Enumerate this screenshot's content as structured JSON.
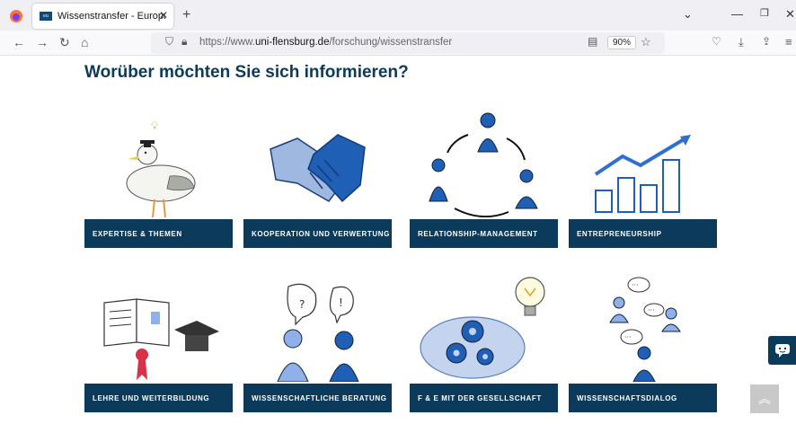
{
  "browser": {
    "tab_title": "Wissenstransfer - Europa-Unive",
    "tab_close": "✕",
    "new_tab": "+",
    "url_prefix": "https://www.",
    "url_domain": "uni-flensburg.de",
    "url_path": "/forschung/wissenstransfer",
    "zoom": "90%"
  },
  "page": {
    "title": "Worüber möchten Sie sich informieren?"
  },
  "cards": [
    {
      "label": "EXPERTISE & THEMEN",
      "icon": "seagull-graduate-icon"
    },
    {
      "label": "KOOPERATION UND VERWERTUNG",
      "icon": "handshake-icon"
    },
    {
      "label": "RELATIONSHIP-MANAGEMENT",
      "icon": "people-cycle-icon"
    },
    {
      "label": "ENTREPRENEURSHIP",
      "icon": "growth-chart-icon"
    },
    {
      "label": "LEHRE UND WEITERBILDUNG",
      "icon": "book-graduation-icon"
    },
    {
      "label": "WISSENSCHAFTLICHE BERATUNG",
      "icon": "consulting-people-icon"
    },
    {
      "label": "F & E MIT DER GESELLSCHAFT",
      "icon": "brain-gears-icon"
    },
    {
      "label": "WISSENSCHAFTSDIALOG",
      "icon": "dialog-people-icon"
    }
  ],
  "colors": {
    "brand": "#0c3a5a",
    "figure_blue": "#1f5fb5",
    "light_blue": "#8fb0e8"
  }
}
